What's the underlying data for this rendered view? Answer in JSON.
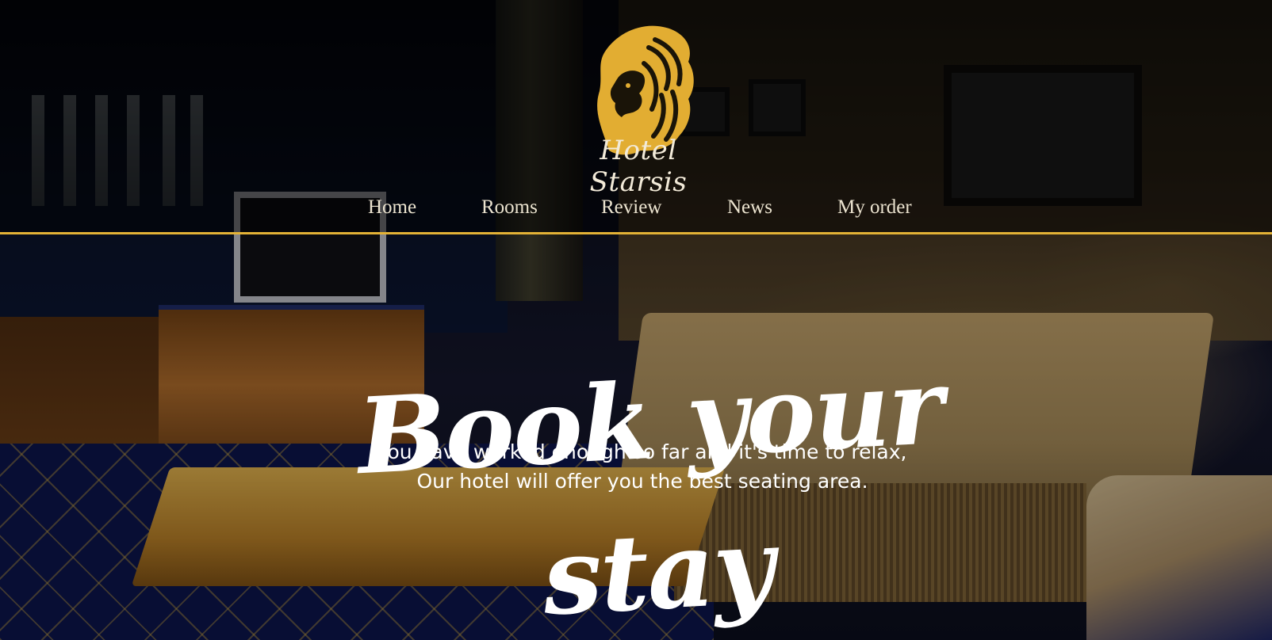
{
  "brand": {
    "name": "Hotel Starsis",
    "logo_icon": "lion-head-icon",
    "accent_color": "#e3b236"
  },
  "nav": {
    "items": [
      {
        "label": "Home"
      },
      {
        "label": "Rooms"
      },
      {
        "label": "Review"
      },
      {
        "label": "News"
      },
      {
        "label": "My order"
      }
    ]
  },
  "hero": {
    "title": "Book your stay",
    "subtitle_line1": "You have worked enough so far and it's time to relax,",
    "subtitle_line2": "Our hotel will offer you the best seating area."
  }
}
